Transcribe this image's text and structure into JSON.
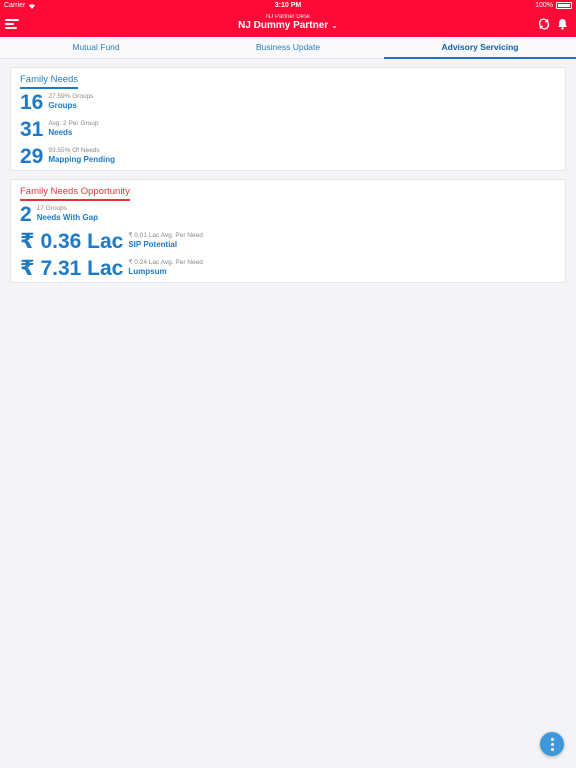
{
  "status_bar": {
    "carrier": "Carrier",
    "time": "3:10 PM",
    "battery": "100%"
  },
  "header": {
    "subtitle": "NJ Partner Desk",
    "title": "NJ Dummy Partner",
    "chevron": "⌄"
  },
  "tabs": [
    {
      "label": "Mutual Fund",
      "active": false
    },
    {
      "label": "Business Update",
      "active": false
    },
    {
      "label": "Advisory Servicing",
      "active": true
    }
  ],
  "family_needs": {
    "title": "Family Needs",
    "stats": [
      {
        "value": "16",
        "sub": "27.59% Groups",
        "label": "Groups"
      },
      {
        "value": "31",
        "sub": "Avg. 2 Per Group",
        "label": "Needs"
      },
      {
        "value": "29",
        "sub": "93.55% Of Needs",
        "label": "Mapping Pending"
      }
    ]
  },
  "family_needs_opportunity": {
    "title": "Family Needs Opportunity",
    "stats": [
      {
        "value": "2",
        "sub": "17 Groups",
        "label": "Needs With Gap"
      },
      {
        "value": "₹ 0.36 Lac",
        "sub": "₹ 0.01 Lac Avg. Per Need",
        "label": "SIP Potential"
      },
      {
        "value": "₹ 7.31 Lac",
        "sub": "₹ 0.24 Lac Avg. Per Need",
        "label": "Lumpsum"
      }
    ]
  },
  "colors": {
    "header": "#ff0a36",
    "accent": "#1d7ac8",
    "opportunity": "#e6343d",
    "fab": "#3f97dc"
  }
}
